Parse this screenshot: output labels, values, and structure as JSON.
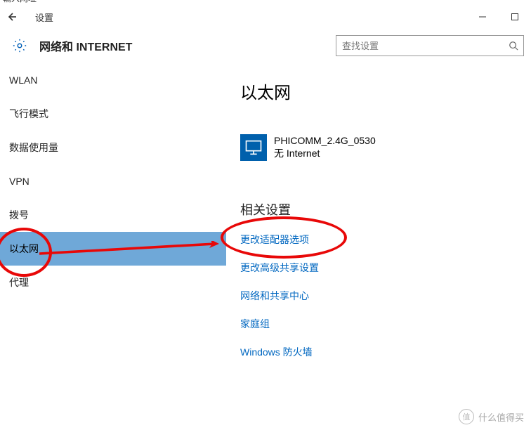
{
  "addrbar": {
    "text": "輸入网址"
  },
  "titlebar": {
    "title": "设置"
  },
  "header": {
    "title": "网络和 INTERNET",
    "search_placeholder": "查找设置"
  },
  "sidebar": {
    "items": [
      {
        "label": "WLAN"
      },
      {
        "label": "飞行模式"
      },
      {
        "label": "数据使用量"
      },
      {
        "label": "VPN"
      },
      {
        "label": "拨号"
      },
      {
        "label": "以太网"
      },
      {
        "label": "代理"
      }
    ],
    "selected_index": 5
  },
  "main": {
    "page_title": "以太网",
    "network": {
      "name": "PHICOMM_2.4G_0530",
      "status": "无 Internet"
    },
    "related_heading": "相关设置",
    "links": [
      "更改适配器选项",
      "更改高级共享设置",
      "网络和共享中心",
      "家庭组",
      "Windows 防火墙"
    ]
  },
  "watermark": {
    "badge": "值",
    "text": "什么值得买"
  }
}
